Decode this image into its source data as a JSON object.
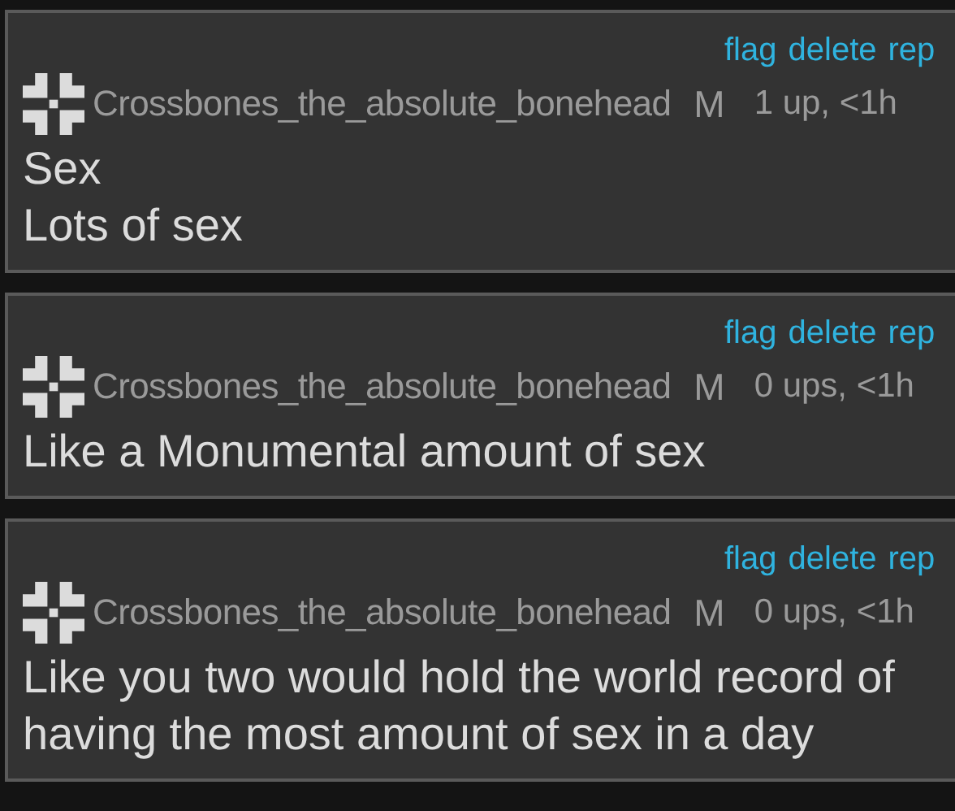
{
  "comments": [
    {
      "actions": [
        "flag",
        "delete",
        "rep"
      ],
      "username": "Crossbones_the_absolute_bonehead",
      "badge": "M",
      "meta": "1 up, <1h",
      "lines": [
        "Sex",
        "Lots of sex"
      ]
    },
    {
      "actions": [
        "flag",
        "delete",
        "rep"
      ],
      "username": "Crossbones_the_absolute_bonehead",
      "badge": "M",
      "meta": "0 ups, <1h",
      "lines": [
        "Like a Monumental amount of sex"
      ]
    },
    {
      "actions": [
        "flag",
        "delete",
        "rep"
      ],
      "username": "Crossbones_the_absolute_bonehead",
      "badge": "M",
      "meta": "0 ups, <1h",
      "lines": [
        "Like you two would hold the world record of",
        "having the most amount of sex in a day"
      ]
    }
  ]
}
